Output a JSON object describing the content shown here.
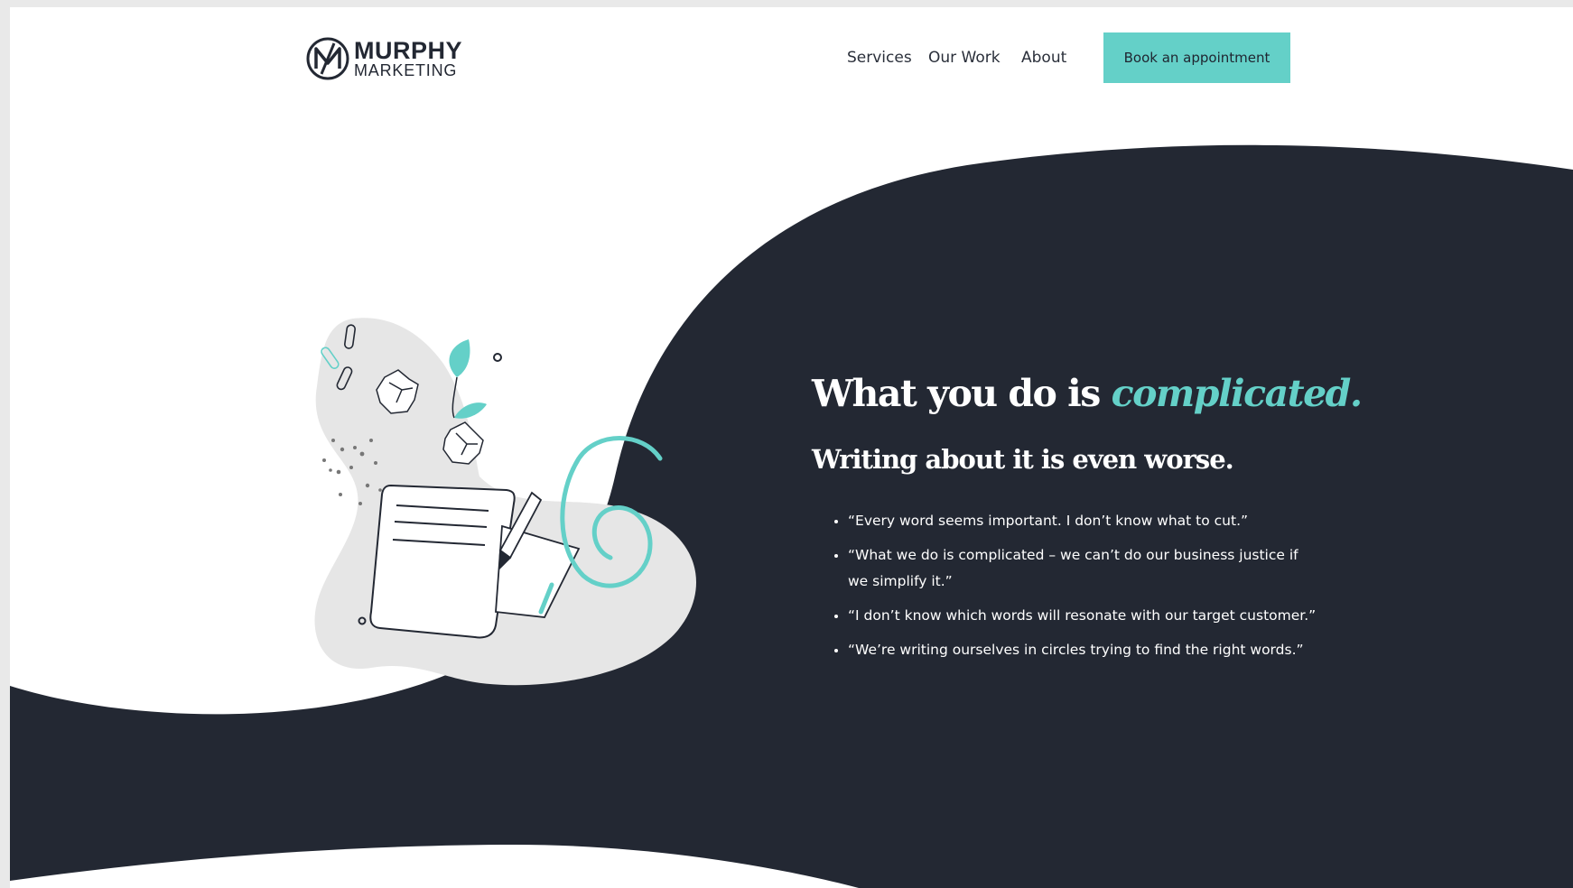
{
  "brand": {
    "name_line1": "MURPHY",
    "name_line2": "MARKETING"
  },
  "nav": {
    "items": [
      {
        "label": "Services"
      },
      {
        "label": "Our Work"
      },
      {
        "label": "About"
      }
    ],
    "cta_label": "Book an appointment"
  },
  "hero": {
    "headline_lead": "What you do is ",
    "headline_accent": "complicated.",
    "subheadline": "Writing about it is even worse.",
    "quotes": [
      "“Every word seems important. I don’t know what to cut.”",
      "“What we do is complicated – we can’t do our business justice if we simplify it.”",
      "“I don’t know which words will resonate with our target customer.”",
      "“We’re writing ourselves in circles trying to find the right words.”"
    ]
  },
  "colors": {
    "dark_navy": "#232833",
    "teal_accent": "#64d0c8",
    "blob_gray": "#e6e6e6",
    "white": "#ffffff"
  },
  "icons": {
    "logo": "m-monogram-icon",
    "illustration": "notepad-pencil-illustration"
  }
}
